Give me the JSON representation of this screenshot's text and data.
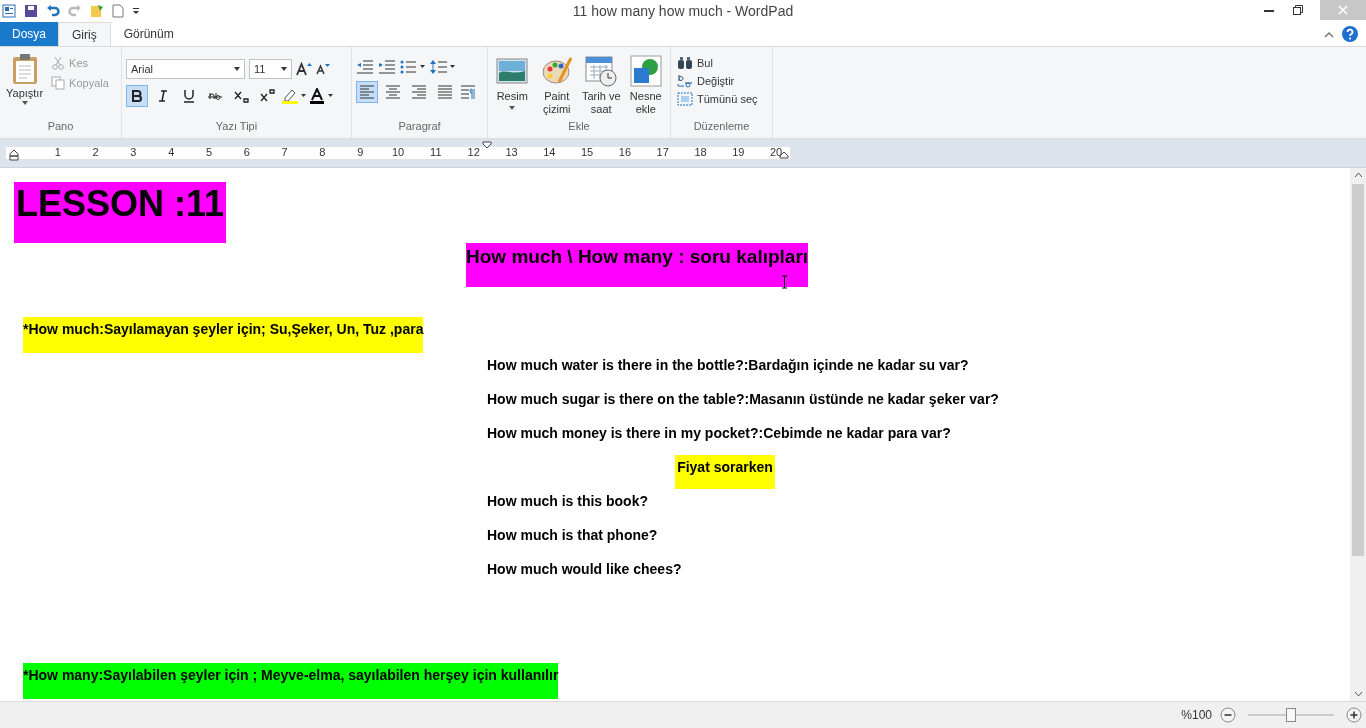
{
  "window": {
    "title": "11 how many how much - WordPad"
  },
  "tabs": [
    {
      "label": "Dosya",
      "kind": "file",
      "selected": false
    },
    {
      "label": "Giriş",
      "kind": "tab",
      "selected": true
    },
    {
      "label": "Görünüm",
      "kind": "tab",
      "selected": false
    }
  ],
  "clipboard": {
    "paste": "Yapıştır",
    "cut": {
      "label": "Kes",
      "disabled": true
    },
    "copy": {
      "label": "Kopyala",
      "disabled": true
    },
    "group": "Pano"
  },
  "font": {
    "family": "Arial",
    "size": "11",
    "group": "Yazı Tipi",
    "format_buttons": [
      {
        "kind": "bold",
        "selected": true
      },
      {
        "kind": "italic",
        "selected": false
      },
      {
        "kind": "underline",
        "selected": false
      },
      {
        "kind": "strike",
        "selected": false
      },
      {
        "kind": "sub",
        "selected": false
      },
      {
        "kind": "sup",
        "selected": false
      }
    ]
  },
  "paragraph": {
    "group": "Paragraf",
    "align_buttons": [
      {
        "kind": "left",
        "selected": true
      },
      {
        "kind": "center",
        "selected": false
      },
      {
        "kind": "right",
        "selected": false
      },
      {
        "kind": "justify",
        "selected": false
      }
    ]
  },
  "insert": {
    "group": "Ekle",
    "items": [
      {
        "kind": "picture",
        "label": "Resim"
      },
      {
        "kind": "paint",
        "label": "Paint çizimi"
      },
      {
        "kind": "date",
        "label": "Tarih ve saat"
      },
      {
        "kind": "object",
        "label": "Nesne ekle"
      }
    ]
  },
  "editing": {
    "group": "Düzenleme",
    "items": [
      {
        "kind": "find",
        "label": "Bul"
      },
      {
        "kind": "replace",
        "label": "Değiştir"
      },
      {
        "kind": "selectall",
        "label": "Tümünü seç"
      }
    ]
  },
  "ruler": {
    "marks": [
      "1",
      "2",
      "3",
      "4",
      "5",
      "6",
      "7",
      "8",
      "9",
      "10",
      "11",
      "12",
      "13",
      "14",
      "15",
      "16",
      "17",
      "18",
      "19",
      "20"
    ]
  },
  "document": [
    {
      "kind": "title",
      "text": "LESSON :11",
      "color": "#ff00ff"
    },
    {
      "kind": "heading",
      "text": "How much \\  How many  :  soru kalıpları",
      "color": "#ff00ff"
    },
    {
      "kind": "note",
      "text": "*How much:Sayılamayan şeyler için; Su,Şeker, Un, Tuz ,para",
      "color": "#ffff00"
    },
    {
      "kind": "line",
      "text": "How much water is there in the bottle?:Bardağın içinde ne kadar su var?"
    },
    {
      "kind": "line",
      "text": "How much sugar is there on the table?:Masanın üstünde ne kadar şeker var?"
    },
    {
      "kind": "line",
      "text": "How much money is there in my pocket?:Cebimde ne kadar para var?"
    },
    {
      "kind": "sub",
      "text": "Fiyat sorarken",
      "color": "#ffff00"
    },
    {
      "kind": "line",
      "text": "How much is this book?"
    },
    {
      "kind": "line",
      "text": "How much is that phone?"
    },
    {
      "kind": "line",
      "text": "How much would like chees?"
    },
    {
      "kind": "note2",
      "text": "*How many:Sayılabilen şeyler için ; Meyve-elma, sayılabilen herşey için kullanılır",
      "color": "#00ff00"
    }
  ],
  "status_bar": {
    "zoom": "%100",
    "level": 0.5
  }
}
